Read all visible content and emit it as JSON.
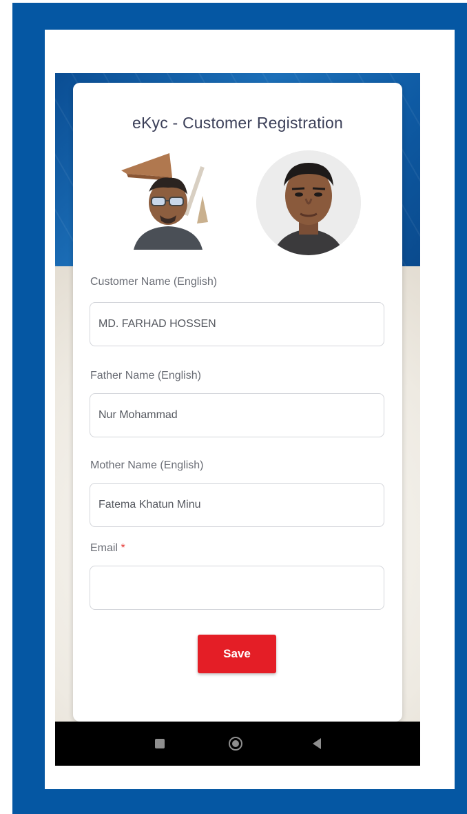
{
  "app": {
    "title": "eKyc - Customer Registration"
  },
  "form": {
    "customer_name": {
      "label": "Customer Name (English)",
      "value": "MD. FARHAD HOSSEN"
    },
    "father_name": {
      "label": "Father Name (English)",
      "value": "Nur Mohammad"
    },
    "mother_name": {
      "label": "Mother Name (English)",
      "value": "Fatema Khatun Minu"
    },
    "email": {
      "label": "Email",
      "required_mark": "*",
      "value": ""
    },
    "save_label": "Save"
  },
  "navbar": {
    "icons": [
      "square-icon",
      "home-circle-icon",
      "back-triangle-icon"
    ]
  },
  "colors": {
    "frame": "#0557a3",
    "accent_button": "#e41e26",
    "title_text": "#3b3f58",
    "navbar": "#000000"
  }
}
